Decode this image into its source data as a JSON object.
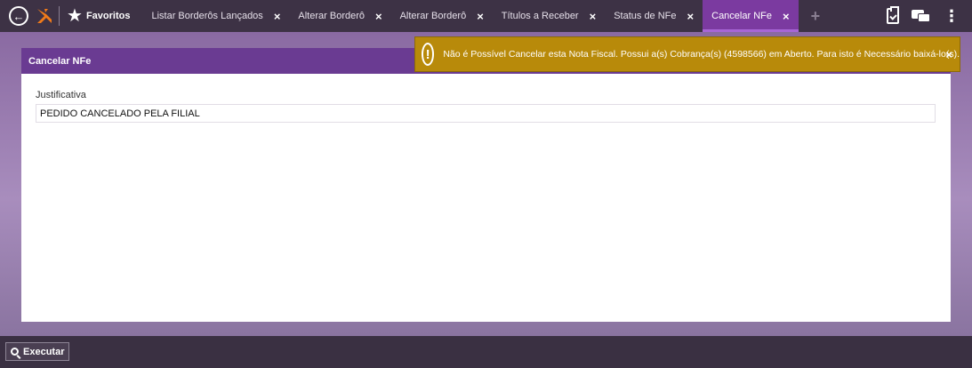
{
  "favorites": {
    "label": "Favoritos"
  },
  "tabs": [
    {
      "label": "Listar Borderôs Lançados",
      "active": false
    },
    {
      "label": "Alterar Borderô",
      "active": false
    },
    {
      "label": "Alterar Borderô",
      "active": false
    },
    {
      "label": "Títulos a Receber",
      "active": false
    },
    {
      "label": "Status de NFe",
      "active": false
    },
    {
      "label": "Cancelar NFe",
      "active": true
    }
  ],
  "tab_close_glyph": "×",
  "add_tab_glyph": "+",
  "panel": {
    "title": "Cancelar NFe",
    "field_label": "Justificativa",
    "field_value": "PEDIDO CANCELADO PELA FILIAL"
  },
  "alert": {
    "icon_glyph": "!",
    "message": "Não é Possível Cancelar esta Nota Fiscal. Possui a(s) Cobrança(s) (4598566) em Aberto. Para isto é Necessário baixá-lo(s).",
    "close_glyph": "×",
    "color": "#b88a0a"
  },
  "bottom": {
    "execute_label": "Executar"
  },
  "colors": {
    "accent": "#7b3aa0",
    "header": "#6a3b92"
  },
  "icons": {
    "back": "arrow-left-circle-icon",
    "logo": "brand-logo-icon",
    "star": "star-icon",
    "clipboard": "clipboard-check-icon",
    "chat": "chat-icon",
    "more": "kebab-menu-icon"
  }
}
